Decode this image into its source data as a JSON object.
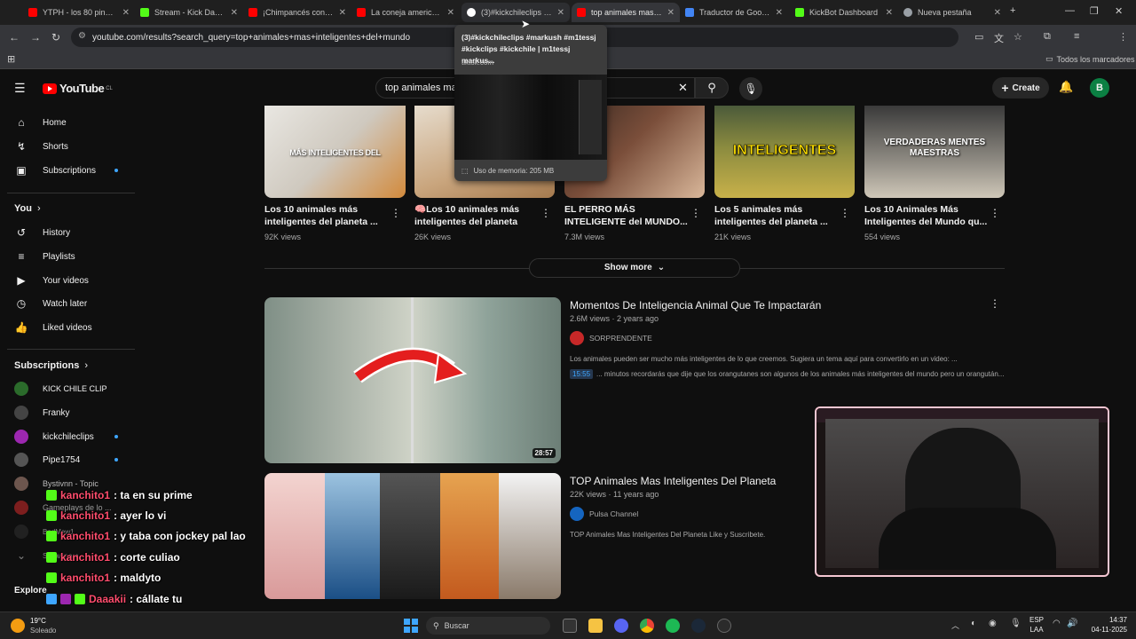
{
  "browser": {
    "tabs": [
      {
        "title": "YTPH - los 80 pinoche",
        "color": "#ff0000"
      },
      {
        "title": "Stream - Kick Dashbo",
        "color": "#53fc18"
      },
      {
        "title": "¡Chimpancés con Má",
        "color": "#ff0000"
      },
      {
        "title": "La coneja america ad",
        "color": "#ff0000"
      },
      {
        "title": "(3)#kickchileclips #m",
        "color": "#ffffff"
      },
      {
        "title": "top animales mas inte",
        "color": "#ff0000"
      },
      {
        "title": "Traductor de Google",
        "color": "#4285f4"
      },
      {
        "title": "KickBot Dashboard",
        "color": "#53fc18"
      },
      {
        "title": "Nueva pestaña",
        "color": "#9aa0a6"
      }
    ],
    "url": "youtube.com/results?search_query=top+animales+mas+inteligentes+del+mundo",
    "bookmarks_label": "Todos los marcadores",
    "profile_letter": "B"
  },
  "tooltip": {
    "title": "(3)#kickchileclips #markush #m1tessj #kickclips #kickchile | m1tessj markus...",
    "domain": "tiktok.com",
    "memory": "Uso de memoria: 205 MB"
  },
  "youtube": {
    "logo": "YouTube",
    "country": "CL",
    "search_value": "top animales ma",
    "create_label": "Create",
    "avatar_letter": "B"
  },
  "sidebar": {
    "main": [
      "Home",
      "Shorts",
      "Subscriptions"
    ],
    "you_label": "You",
    "you_items": [
      "History",
      "Playlists",
      "Your videos",
      "Watch later",
      "Liked videos"
    ],
    "subs_label": "Subscriptions",
    "subs": [
      "KICK CHILE CLIP",
      "Franky",
      "kickchileclips",
      "Pipe1754",
      "Bystivnn - Topic",
      "Gameplays de lo ...",
      "BadMew1"
    ],
    "show_more": "Show more",
    "explore_label": "Explore"
  },
  "top_row": [
    {
      "title1": "Los 10 animales más",
      "title2": "inteligentes del planeta ...",
      "views": "92K views",
      "overlay": "MÁS INTELIGENTES DEL"
    },
    {
      "title1": "🧠Los 10 animales más",
      "title2": "inteligentes del planeta",
      "views": "26K views",
      "overlay": ""
    },
    {
      "title1": "EL PERRO MÁS",
      "title2": "INTELIGENTE del MUNDO...",
      "views": "7.3M views",
      "overlay": ""
    },
    {
      "title1": "Los 5 animales más",
      "title2": "inteligentes del planeta ...",
      "views": "21K views",
      "overlay": "INTELIGENTES"
    },
    {
      "title1": "Los 10 Animales Más",
      "title2": "Inteligentes del Mundo qu...",
      "views": "554 views",
      "overlay": "VERDADERAS MENTES MAESTRAS"
    }
  ],
  "show_more_label": "Show more",
  "videos": [
    {
      "title": "Momentos De Inteligencia Animal Que Te Impactarán",
      "meta": "2.6M views · 2 years ago",
      "channel": "SORPRENDENTE",
      "desc": "Los animales pueden ser mucho más inteligentes de lo que creemos. Sugiera un tema aquí para convertirlo en un video: ...",
      "chapter_time": "15:55",
      "chapter_text": "... minutos recordarás que dije que los orangutanes son algunos de los animales más inteligentes del mundo pero un orangután...",
      "duration": "28:57"
    },
    {
      "title": "TOP Animales Mas Inteligentes Del Planeta",
      "meta": "22K views · 11 years ago",
      "channel": "Pulsa Channel",
      "desc": "TOP Animales Mas Inteligentes Del Planeta Like y Suscribete."
    }
  ],
  "chat": [
    {
      "user": "kanchito1",
      "msg": ": ta en su prime"
    },
    {
      "user": "kanchito1",
      "msg": ": ayer lo vi"
    },
    {
      "user": "kanchito1",
      "msg": ": y taba con jockey pal lao"
    },
    {
      "user": "kanchito1",
      "msg": ": corte culiao"
    },
    {
      "user": "kanchito1",
      "msg": ": maldyto"
    },
    {
      "user": "Daaakii",
      "msg": ": cállate tu"
    }
  ],
  "taskbar": {
    "weather_temp": "19°C",
    "weather_desc": "Soleado",
    "search_label": "Buscar",
    "lang1": "ESP",
    "lang2": "LAA",
    "time": "14:37",
    "date": "04-11-2025"
  }
}
